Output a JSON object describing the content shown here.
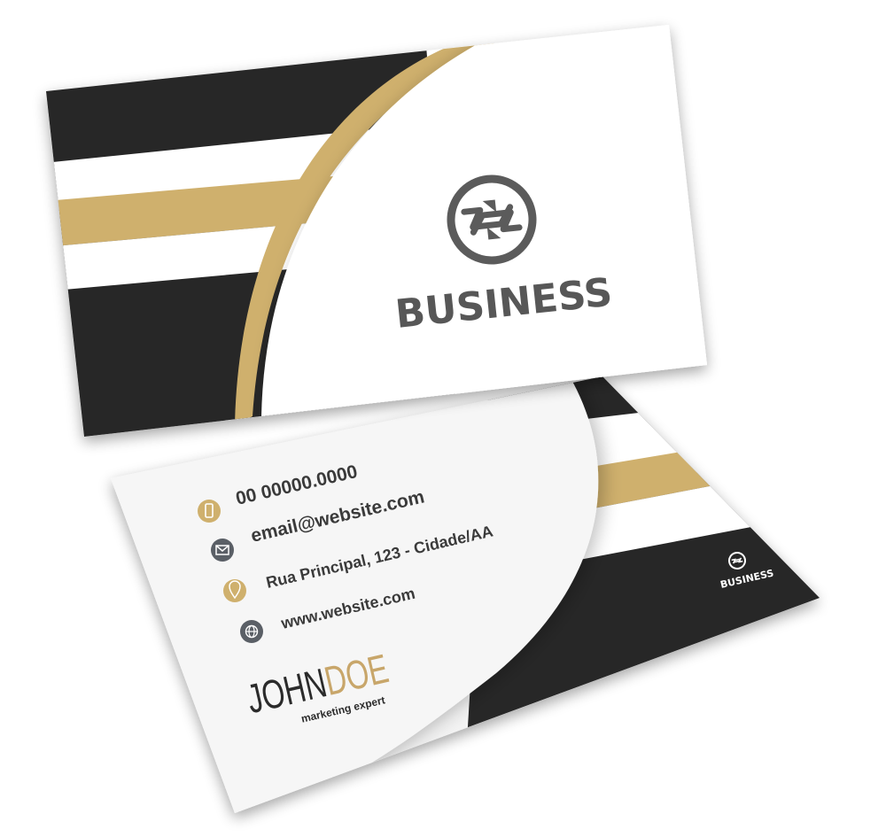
{
  "colors": {
    "dark": "#272727",
    "gold": "#cfb06d",
    "white": "#ffffff",
    "paper": "#f5f5f5",
    "icon_dark": "#5a5f66"
  },
  "front_card": {
    "logo_icon": "circle-zigzag-arrows-icon",
    "brand": "BUSINESS"
  },
  "back_card": {
    "contacts": [
      {
        "icon": "phone-icon",
        "text": "00 00000.0000"
      },
      {
        "icon": "envelope-icon",
        "text": "email@website.com"
      },
      {
        "icon": "map-pin-icon",
        "text": "Rua Principal, 123 - Cidade/AA"
      },
      {
        "icon": "globe-icon",
        "text": "www.website.com"
      }
    ],
    "name_first": "JOHN",
    "name_last": "DOE",
    "role": "marketing expert",
    "small_logo_icon": "circle-zigzag-arrows-icon",
    "small_brand": "BUSINESS"
  }
}
